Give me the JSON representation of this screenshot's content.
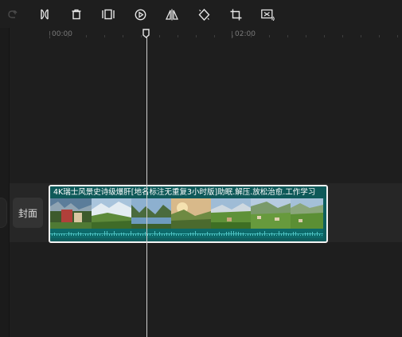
{
  "toolbar": {
    "buttons": [
      {
        "icon": "redo-icon",
        "enabled": false
      },
      {
        "icon": "split-icon",
        "enabled": true
      },
      {
        "icon": "delete-icon",
        "enabled": true
      },
      {
        "icon": "freeze-frame-icon",
        "enabled": true
      },
      {
        "icon": "play-segment-icon",
        "enabled": true
      },
      {
        "icon": "mirror-icon",
        "enabled": true
      },
      {
        "icon": "rotate-icon",
        "enabled": true
      },
      {
        "icon": "crop-icon",
        "enabled": true
      },
      {
        "icon": "smart-cutout-icon",
        "enabled": true
      }
    ]
  },
  "ruler": {
    "labels": [
      "00:00",
      "02:00"
    ]
  },
  "track": {
    "cover_label": "封面"
  },
  "clip": {
    "title": "4K瑞士风景史诗级爆肝[地名标注无重复3小时版]助眠.解压.放松治愈.工作学习"
  },
  "colors": {
    "background": "#1e1e1e",
    "clip_fill": "#0f5e5e",
    "clip_border": "#f2f2f2",
    "playhead": "#d0d0d0"
  }
}
